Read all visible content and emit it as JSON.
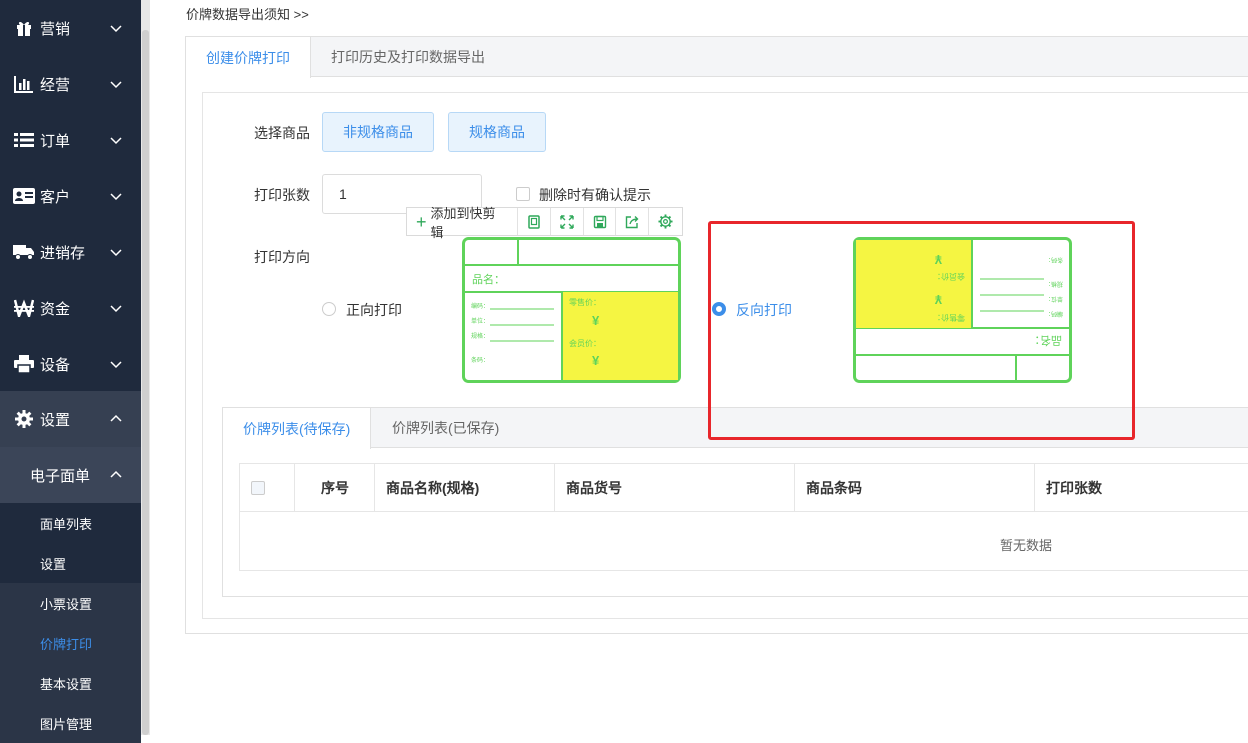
{
  "sidebar": {
    "menu": [
      {
        "label": "营销",
        "icon": "gift-icon"
      },
      {
        "label": "经营",
        "icon": "bar-chart-icon"
      },
      {
        "label": "订单",
        "icon": "list-icon"
      },
      {
        "label": "客户",
        "icon": "id-card-icon"
      },
      {
        "label": "进销存",
        "icon": "truck-icon"
      },
      {
        "label": "资金",
        "icon": "won-icon"
      },
      {
        "label": "设备",
        "icon": "printer-icon"
      },
      {
        "label": "设置",
        "icon": "gear-icon"
      }
    ],
    "submenu_header": "电子面单",
    "sub_items": [
      "面单列表",
      "设置",
      "小票设置",
      "价牌打印",
      "基本设置",
      "图片管理"
    ],
    "active_sub": "价牌打印"
  },
  "top_note": "价牌数据导出须知 >>",
  "tabs": [
    "创建价牌打印",
    "打印历史及打印数据导出"
  ],
  "form": {
    "select_goods_label": "选择商品",
    "btn_non_spec": "非规格商品",
    "btn_spec": "规格商品",
    "print_count_label": "打印张数",
    "print_count_value": "1",
    "confirm_checkbox_label": "删除时有确认提示",
    "direction_label": "打印方向",
    "forward_label": "正向打印",
    "reverse_label": "反向打印",
    "selected_direction": "reverse"
  },
  "toolbar": {
    "add_label": "添加到快剪辑",
    "icons": [
      "copy-icon",
      "expand-icon",
      "save-icon",
      "share-icon",
      "settings-icon"
    ]
  },
  "label_template": {
    "name": "品名：",
    "retail_price": "零售价：",
    "member_price": "会员价：",
    "currency": "¥",
    "fields": [
      "编码：",
      "单位：",
      "规格：",
      "条码："
    ]
  },
  "list": {
    "tabs": [
      "价牌列表(待保存)",
      "价牌列表(已保存)"
    ],
    "columns": [
      "序号",
      "商品名称(规格)",
      "商品货号",
      "商品条码",
      "打印张数"
    ],
    "empty_text": "暂无数据"
  },
  "colors": {
    "sidebar_bg": "#1f2a3d",
    "accent": "#3c8ee9",
    "label_green": "#5fd35a",
    "label_yellow": "#f5f542",
    "highlight_red": "#e8262b"
  }
}
